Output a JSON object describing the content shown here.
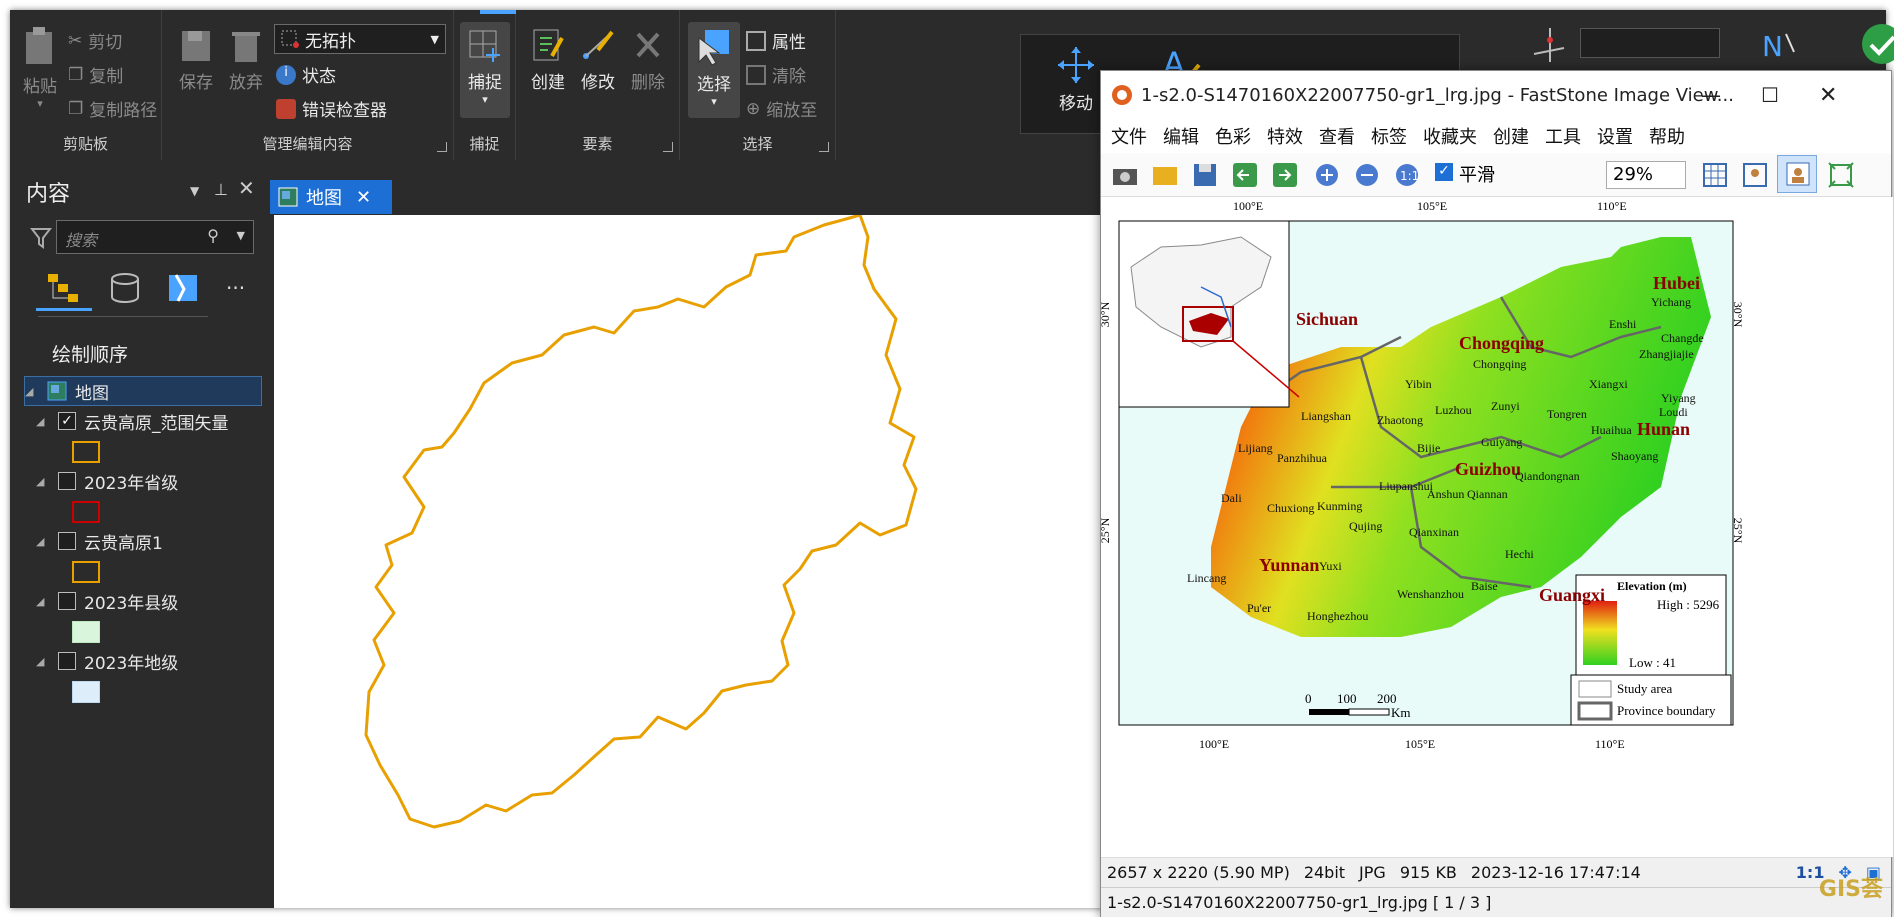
{
  "ribbon": {
    "clipboard": {
      "paste": "粘贴",
      "cut": "剪切",
      "copy": "复制",
      "copy_path": "复制路径",
      "label": "剪贴板"
    },
    "manage": {
      "save": "保存",
      "discard": "放弃",
      "topology_value": "无拓扑",
      "status": "状态",
      "error_inspector": "错误检查器",
      "label": "管理编辑内容"
    },
    "snap": {
      "button": "捕捉",
      "label": "捕捉"
    },
    "features": {
      "create": "创建",
      "modify": "修改",
      "delete": "删除",
      "label": "要素"
    },
    "selection": {
      "select": "选择",
      "attributes": "属性",
      "clear": "清除",
      "zoom_to": "缩放至",
      "label": "选择"
    },
    "tools": {
      "move": "移动"
    }
  },
  "contents": {
    "title": "内容",
    "search_placeholder": "搜索",
    "drawing_order": "绘制顺序",
    "map_item": "地图",
    "layers": [
      {
        "name": "云贵高原_范围矢量",
        "checked": true,
        "color": "#e8a000",
        "fill": "none"
      },
      {
        "name": "2023年省级",
        "checked": false,
        "color": "#cc0000",
        "fill": "none"
      },
      {
        "name": "云贵高原1",
        "checked": false,
        "color": "#e8a000",
        "fill": "none"
      },
      {
        "name": "2023年县级",
        "checked": false,
        "color": "#bde8c0",
        "fill": "#d9f5dc"
      },
      {
        "name": "2023年地级",
        "checked": false,
        "color": "#bcd8ee",
        "fill": "#ddeefa"
      }
    ]
  },
  "map_tab": "地图",
  "faststone": {
    "title": "1-s2.0-S1470160X22007750-gr1_lrg.jpg  -  FastStone Image View...",
    "menu": [
      "文件",
      "编辑",
      "色彩",
      "特效",
      "查看",
      "标签",
      "收藏夹",
      "创建",
      "工具",
      "设置",
      "帮助"
    ],
    "smooth": "平滑",
    "zoom": "29%",
    "status_info": [
      "2657 x 2220 (5.90 MP)",
      "24bit",
      "JPG",
      "915 KB",
      "2023-12-16 17:47:14"
    ],
    "ratio": "1:1",
    "filename": "1-s2.0-S1470160X22007750-gr1_lrg.jpg [ 1 / 3 ]",
    "watermark": "GIS荟"
  },
  "figure": {
    "top_ticks": [
      "100°E",
      "105°E",
      "110°E"
    ],
    "bottom_ticks": [
      "100°E",
      "105°E",
      "110°E"
    ],
    "left_ticks": [
      "30°N",
      "25°N"
    ],
    "right_ticks": [
      "30°N",
      "25°N"
    ],
    "provinces": [
      "Sichuan",
      "Chongqing",
      "Hubei",
      "Hunan",
      "Guizhou",
      "Yunnan",
      "Guangxi"
    ],
    "cities": [
      "Yichang",
      "Enshi",
      "Changde",
      "Zhangjiajie",
      "Chongqing",
      "Xiangxi",
      "Yiyang",
      "Loudi",
      "Yibin",
      "Luzhou",
      "Zunyi",
      "Tongren",
      "Huaihua",
      "Liangshan",
      "Zhaotong",
      "Lijiang",
      "Panzhihua",
      "Bijie",
      "Guiyang",
      "Shaoyang",
      "Qiandongnan",
      "Dali",
      "Liupanshui",
      "Anshun",
      "Qiannan",
      "Chuxiong",
      "Kunming",
      "Qujing",
      "Qianxinan",
      "Yuxi",
      "Hechi",
      "Lincang",
      "Wenshanzhou",
      "Baise",
      "Pu'er",
      "Honghezhou"
    ],
    "legend_title": "Elevation (m)",
    "legend_high": "High : 5296",
    "legend_low": "Low : 41",
    "study_area": "Study area",
    "province_boundary": "Province boundary",
    "scale_labels": [
      "0",
      "100",
      "200"
    ],
    "scale_unit": "Km"
  }
}
